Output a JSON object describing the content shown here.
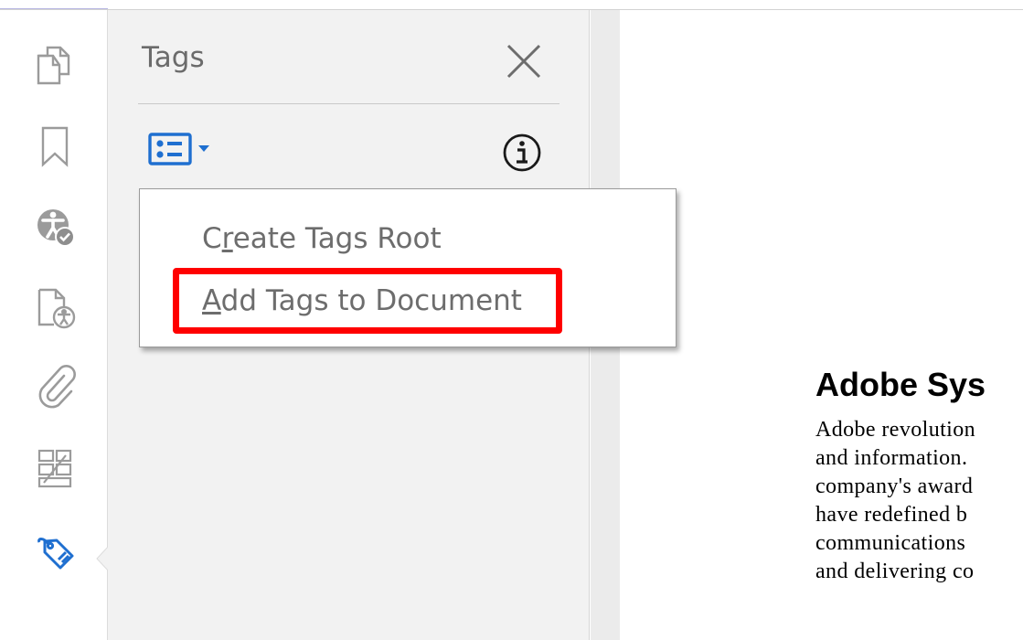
{
  "rail": {
    "items": [
      {
        "icon": "page-thumbnails-icon"
      },
      {
        "icon": "bookmark-icon"
      },
      {
        "icon": "accessibility-checker-icon"
      },
      {
        "icon": "accessibility-report-icon"
      },
      {
        "icon": "attachment-paperclip-icon"
      },
      {
        "icon": "order-content-icon"
      },
      {
        "icon": "tag-icon",
        "active": true
      }
    ]
  },
  "panel": {
    "title": "Tags",
    "close_icon": "close-icon",
    "options_icon": "options-list-icon",
    "info_icon": "info-icon"
  },
  "menu": {
    "items": [
      {
        "label": "Create Tags Root",
        "mnemonic": "r"
      },
      {
        "label": "Add Tags to Document",
        "mnemonic": "A",
        "highlighted": true
      }
    ]
  },
  "document": {
    "heading": "Adobe Sys",
    "lines": [
      "Adobe revolution",
      "and information.",
      "company's award",
      "have redefined b",
      "communications",
      "and delivering co"
    ]
  },
  "colors": {
    "icon_gray": "#9b9b9b",
    "active_icon_blue": "#1f6fd0",
    "highlight_red": "#ff0000",
    "panel_bg": "#f2f2f2"
  }
}
